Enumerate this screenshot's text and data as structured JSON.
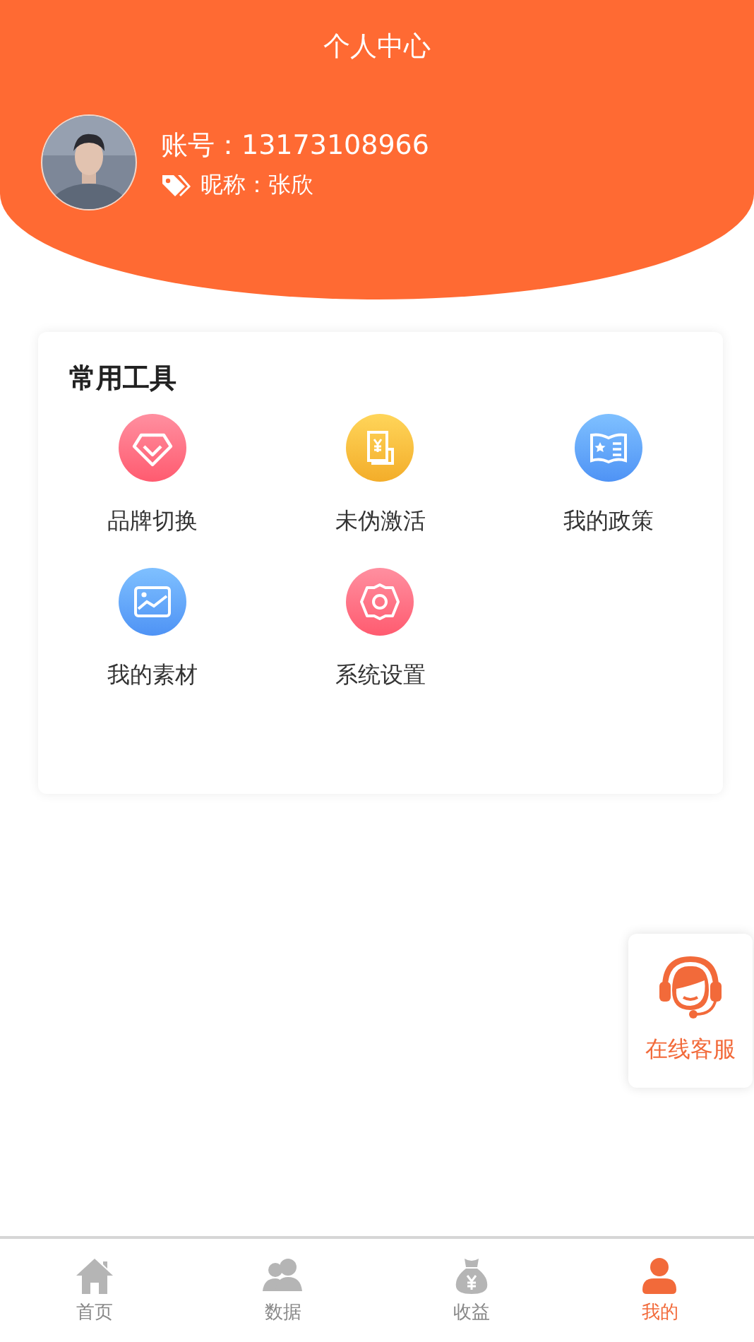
{
  "header": {
    "title": "个人中心",
    "account": "账号：13173108966",
    "nickname": "昵称：张欣"
  },
  "tools": {
    "title": "常用工具",
    "items": [
      {
        "label": "品牌切换"
      },
      {
        "label": "未伪激活"
      },
      {
        "label": "我的政策"
      },
      {
        "label": "我的素材"
      },
      {
        "label": "系统设置"
      }
    ]
  },
  "service": {
    "label": "在线客服"
  },
  "tabs": [
    {
      "label": "首页",
      "selected": false
    },
    {
      "label": "数据",
      "selected": false
    },
    {
      "label": "收益",
      "selected": false
    },
    {
      "label": "我的",
      "selected": true
    }
  ]
}
